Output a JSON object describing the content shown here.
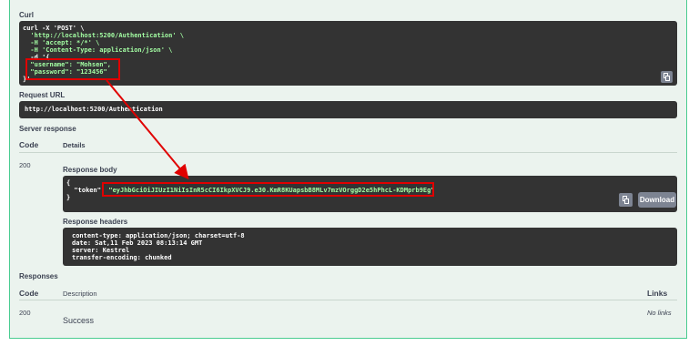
{
  "curl": {
    "title": "Curl",
    "lines": [
      "curl -X 'POST' \\",
      "  'http://localhost:5200/Authentication' \\",
      "  -H 'accept: */*' \\",
      "  -H 'Content-Type: application/json' \\",
      "  -d '{",
      "  \"username\": \"Mohsen\",",
      "  \"password\": \"123456\"",
      "}'"
    ]
  },
  "request_url": {
    "title": "Request URL",
    "value": "http://localhost:5200/Authentication"
  },
  "server_response": {
    "title": "Server response",
    "col_code": "Code",
    "col_details": "Details",
    "code": "200",
    "body_title": "Response body",
    "body_lines": [
      "{",
      "  \"token\": \"eyJhbGciOiJIUzI1NiIsInR5cCI6IkpXVCJ9.e30.KmR8KUapsbB8MLv7mzVOrggD2e5hPhcL-KDMprb9Eg\"",
      "}"
    ],
    "download_label": "Download",
    "headers_title": "Response headers",
    "header_lines": [
      "content-type: application/json; charset=utf-8",
      "date: Sat,11 Feb 2023 08:13:14 GMT",
      "server: Kestrel",
      "transfer-encoding: chunked"
    ]
  },
  "responses": {
    "title": "Responses",
    "col_code": "Code",
    "col_description": "Description",
    "col_links": "Links",
    "code": "200",
    "description": "Success",
    "links": "No links"
  },
  "icons": {
    "copy": "copy-icon",
    "annotation": "red-arrow-annotation"
  },
  "colors": {
    "background": "#ebf3ee",
    "border": "#49cc90",
    "code_bg": "#333333",
    "string_green": "#a2fca2",
    "annotation_red": "#e00000",
    "download_button": "#7d8492"
  }
}
